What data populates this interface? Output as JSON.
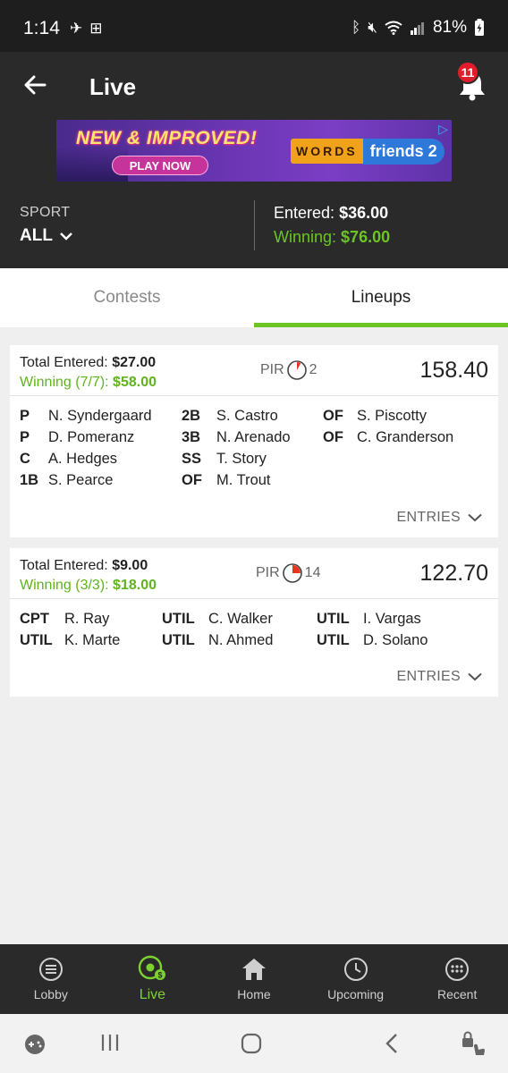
{
  "status_bar": {
    "time": "1:14",
    "battery": "81%"
  },
  "app_bar": {
    "title": "Live",
    "notification_count": "11"
  },
  "banner": {
    "headline": "NEW & IMPROVED!",
    "cta": "PLAY NOW",
    "logo_a": "WORDS",
    "logo_b": "friends 2"
  },
  "filter": {
    "sport_label": "SPORT",
    "sport_value": "ALL",
    "entered_label": "Entered:",
    "entered_value": "$36.00",
    "winning_label": "Winning:",
    "winning_value": "$76.00"
  },
  "tabs": [
    {
      "label": "Contests",
      "active": false
    },
    {
      "label": "Lineups",
      "active": true
    }
  ],
  "lineups": [
    {
      "total_entered_label": "Total Entered:",
      "total_entered_value": "$27.00",
      "winning_label": "Winning (7/7):",
      "winning_value": "$58.00",
      "pir_label": "PIR",
      "pir_value": "2",
      "pir_fraction": 0.08,
      "points": "158.40",
      "players": [
        {
          "pos": "P",
          "name": "N. Syndergaard"
        },
        {
          "pos": "P",
          "name": "D. Pomeranz"
        },
        {
          "pos": "C",
          "name": "A. Hedges"
        },
        {
          "pos": "1B",
          "name": "S. Pearce"
        },
        {
          "pos": "2B",
          "name": "S. Castro"
        },
        {
          "pos": "3B",
          "name": "N. Arenado"
        },
        {
          "pos": "SS",
          "name": "T. Story"
        },
        {
          "pos": "OF",
          "name": "M. Trout"
        },
        {
          "pos": "OF",
          "name": "S. Piscotty"
        },
        {
          "pos": "OF",
          "name": "C. Granderson"
        }
      ],
      "entries_label": "ENTRIES"
    },
    {
      "total_entered_label": "Total Entered:",
      "total_entered_value": "$9.00",
      "winning_label": "Winning (3/3):",
      "winning_value": "$18.00",
      "pir_label": "PIR",
      "pir_value": "14",
      "pir_fraction": 0.25,
      "points": "122.70",
      "players": [
        {
          "pos": "CPT",
          "name": "R. Ray"
        },
        {
          "pos": "UTIL",
          "name": "K. Marte"
        },
        {
          "pos": "UTIL",
          "name": "C. Walker"
        },
        {
          "pos": "UTIL",
          "name": "N. Ahmed"
        },
        {
          "pos": "UTIL",
          "name": "I. Vargas"
        },
        {
          "pos": "UTIL",
          "name": "D. Solano"
        }
      ],
      "entries_label": "ENTRIES"
    }
  ],
  "bottom_nav": [
    {
      "label": "Lobby",
      "icon": "lobby-icon",
      "active": false
    },
    {
      "label": "Live",
      "icon": "live-icon",
      "active": true
    },
    {
      "label": "Home",
      "icon": "home-icon",
      "active": false
    },
    {
      "label": "Upcoming",
      "icon": "upcoming-icon",
      "active": false
    },
    {
      "label": "Recent",
      "icon": "recent-icon",
      "active": false
    }
  ],
  "colors": {
    "accent_green": "#6cc425",
    "header_bg": "#2a2a2a",
    "badge_red": "#e01e2b",
    "pir_red": "#e8361e"
  }
}
